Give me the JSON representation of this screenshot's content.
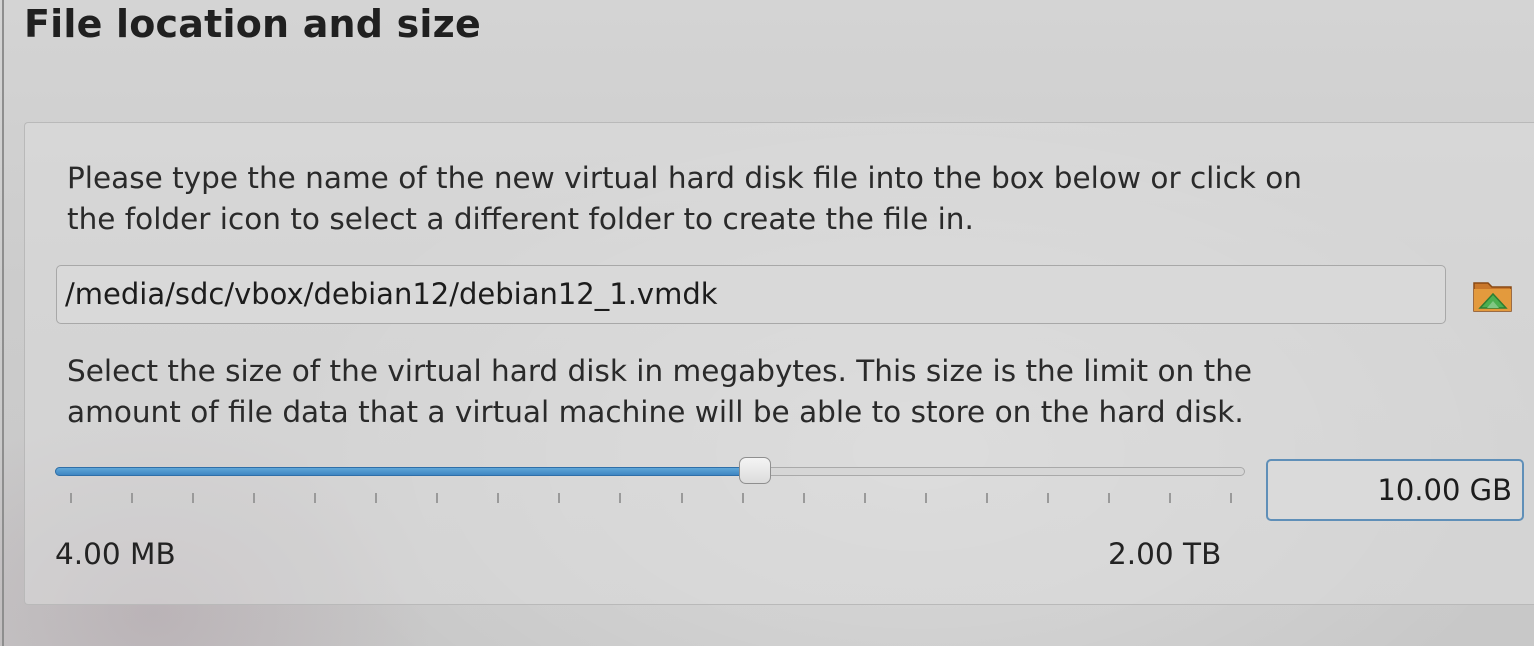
{
  "page": {
    "title": "File location and size"
  },
  "location": {
    "description": [
      "Please type the name of the new virtual hard disk file into the box below or click on",
      "the folder icon to select a different folder to create the file in."
    ],
    "path_value": "/media/sdc/vbox/debian12/debian12_1.vmdk",
    "folder_icon": "folder-open-icon",
    "folder_icon_colors": {
      "base": "#d98a2c",
      "accent": "#4caf50"
    }
  },
  "size": {
    "description": [
      "Select the size of the virtual hard disk in megabytes. This size is the limit on the",
      "amount of file data that a virtual machine will be able to store on the hard disk."
    ],
    "slider_fraction": 0.588,
    "tick_count": 20,
    "value": "10.00 GB",
    "min_label": "4.00 MB",
    "max_label": "2.00 TB",
    "accent_color": "#3f86c2"
  }
}
